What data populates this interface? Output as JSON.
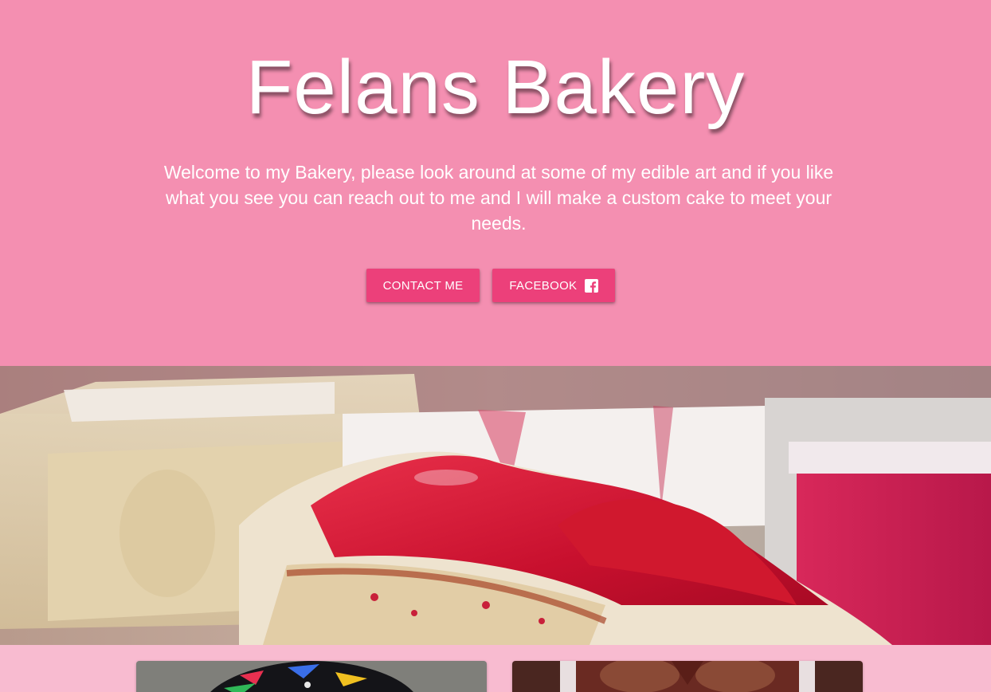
{
  "hero": {
    "title": "Felans Bakery",
    "description": "Welcome to my Bakery, please look around at some of my edible art and if you like what you see you can reach out to me and I will make a custom cake to meet your needs.",
    "buttons": {
      "contact_label": "CONTACT ME",
      "facebook_label": "FACEBOOK",
      "facebook_icon": "facebook-square-icon"
    }
  },
  "banner": {
    "image": "strawberry-cake-slice-photo"
  },
  "gallery": {
    "cards": [
      {
        "image": "dark-cake-with-splatter-photo"
      },
      {
        "image": "chocolate-cake-photo"
      }
    ]
  },
  "colors": {
    "hero_background": "#f48fb1",
    "page_background": "#f8bbd0",
    "button": "#ec407a",
    "text": "#ffffff"
  }
}
